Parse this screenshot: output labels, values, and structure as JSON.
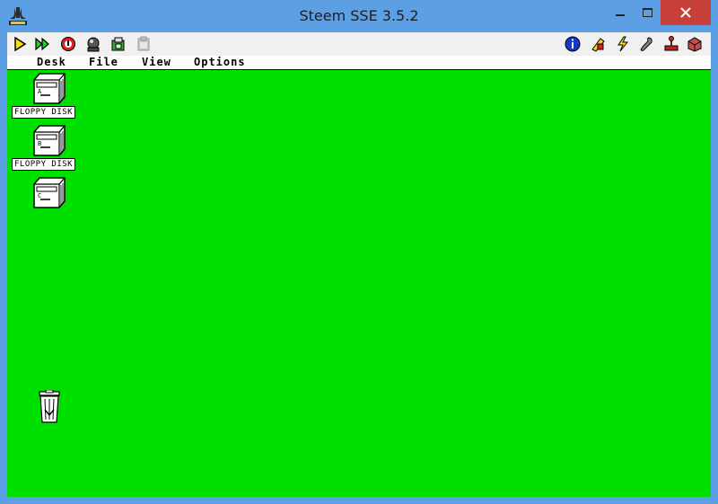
{
  "window": {
    "title": "Steem SSE 3.5.2",
    "controls": [
      "minimize",
      "maximize",
      "close"
    ]
  },
  "toolbar": {
    "left_icons": [
      "play-icon",
      "fast-forward-icon",
      "stop-icon",
      "joystick-reset-icon",
      "snapshot-icon",
      "paste-icon"
    ],
    "right_icons": [
      "info-icon",
      "patches-icon",
      "shortcuts-icon",
      "options-icon",
      "joysticks-icon",
      "disk-manager-icon"
    ]
  },
  "gem_desktop": {
    "background_color": "#00e000",
    "menu": [
      "Desk",
      "File",
      "View",
      "Options"
    ],
    "drives": [
      {
        "letter": "A",
        "label": "FLOPPY DISK"
      },
      {
        "letter": "B",
        "label": "FLOPPY DISK"
      },
      {
        "letter": "C",
        "label": ""
      }
    ],
    "trash": {
      "icon": "trash-icon"
    }
  }
}
